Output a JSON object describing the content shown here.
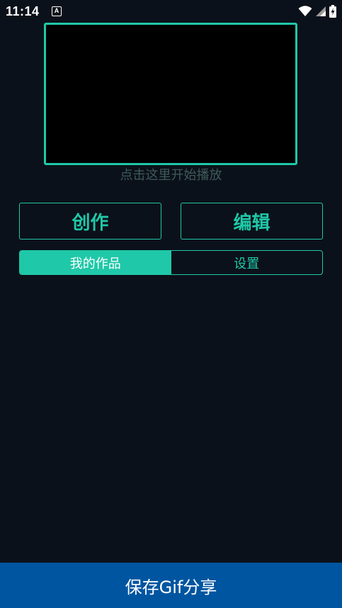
{
  "status_bar": {
    "time": "11:14",
    "notification_badge": "A",
    "icons": [
      "wifi-icon",
      "signal-icon",
      "battery-charging-icon"
    ]
  },
  "preview": {
    "play_hint": "点击这里开始播放"
  },
  "actions": {
    "create_label": "创作",
    "edit_label": "编辑"
  },
  "tabs": [
    {
      "label": "我的作品",
      "active": true
    },
    {
      "label": "设置",
      "active": false
    }
  ],
  "footer": {
    "save_share_label": "保存Gif分享"
  },
  "colors": {
    "background": "#0b111a",
    "accent": "#1fc8a8",
    "hint_text": "#3f5a5a",
    "save_bar": "#0055a0"
  }
}
